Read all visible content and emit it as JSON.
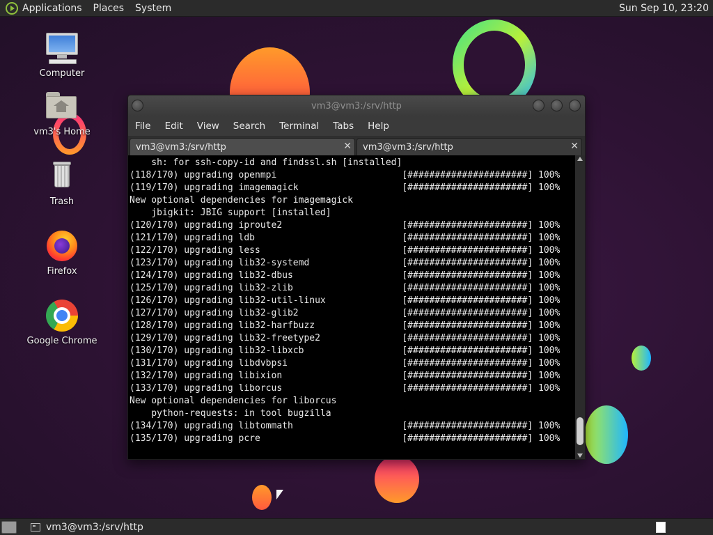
{
  "top_panel": {
    "menus": [
      "Applications",
      "Places",
      "System"
    ],
    "clock": "Sun Sep 10, 23:20"
  },
  "desktop_icons": [
    {
      "label": "Computer",
      "icon": "computer-icon"
    },
    {
      "label": "vm3's Home",
      "icon": "home-folder-icon"
    },
    {
      "label": "Trash",
      "icon": "trash-icon"
    },
    {
      "label": "Firefox",
      "icon": "firefox-icon"
    },
    {
      "label": "Google Chrome",
      "icon": "chrome-icon"
    }
  ],
  "terminal": {
    "title": "vm3@vm3:/srv/http",
    "menubar": [
      "File",
      "Edit",
      "View",
      "Search",
      "Terminal",
      "Tabs",
      "Help"
    ],
    "tabs": [
      {
        "label": "vm3@vm3:/srv/http",
        "active": true
      },
      {
        "label": "vm3@vm3:/srv/http",
        "active": false
      }
    ],
    "tab_close_glyph": "✕",
    "lines": [
      "    sh: for ssh-copy-id and findssl.sh [installed]",
      "(118/170) upgrading openmpi                       [######################] 100%",
      "(119/170) upgrading imagemagick                   [######################] 100%",
      "New optional dependencies for imagemagick",
      "    jbigkit: JBIG support [installed]",
      "(120/170) upgrading iproute2                      [######################] 100%",
      "(121/170) upgrading ldb                           [######################] 100%",
      "(122/170) upgrading less                          [######################] 100%",
      "(123/170) upgrading lib32-systemd                 [######################] 100%",
      "(124/170) upgrading lib32-dbus                    [######################] 100%",
      "(125/170) upgrading lib32-zlib                    [######################] 100%",
      "(126/170) upgrading lib32-util-linux              [######################] 100%",
      "(127/170) upgrading lib32-glib2                   [######################] 100%",
      "(128/170) upgrading lib32-harfbuzz                [######################] 100%",
      "(129/170) upgrading lib32-freetype2               [######################] 100%",
      "(130/170) upgrading lib32-libxcb                  [######################] 100%",
      "(131/170) upgrading libdvbpsi                     [######################] 100%",
      "(132/170) upgrading libixion                      [######################] 100%",
      "(133/170) upgrading liborcus                      [######################] 100%",
      "New optional dependencies for liborcus",
      "    python-requests: in tool bugzilla",
      "(134/170) upgrading libtommath                    [######################] 100%",
      "(135/170) upgrading pcre                          [######################] 100%"
    ]
  },
  "bottom_panel": {
    "task_label": "vm3@vm3:/srv/http"
  }
}
